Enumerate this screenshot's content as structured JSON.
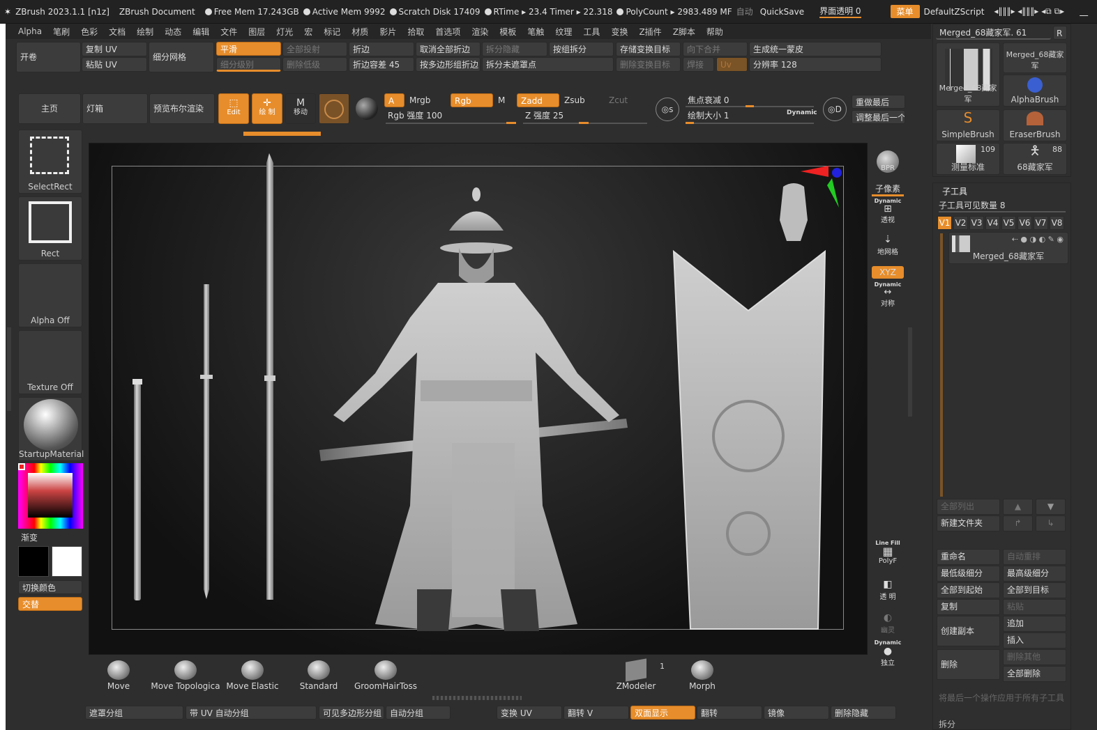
{
  "titlebar": {
    "app": "ZBrush 2023.1.1 [n1z]",
    "document": "ZBrush Document",
    "free_mem": "Free Mem 17.243GB",
    "active_mem": "Active Mem 9992",
    "scratch_disk": "Scratch Disk 17409",
    "rtime": "RTime ▸ 23.4 Timer ▸ 22.318",
    "polycount": "PolyCount ▸ 2983.489 MF",
    "auto": "自动",
    "quicksave": "QuickSave",
    "transparency": "界面透明 0",
    "menu": "菜单",
    "default_zscript": "DefaultZScript"
  },
  "menubar": [
    "Alpha",
    "笔刷",
    "色彩",
    "文档",
    "绘制",
    "动态",
    "编辑",
    "文件",
    "图层",
    "灯光",
    "宏",
    "标记",
    "材质",
    "影片",
    "拾取",
    "首选项",
    "渲染",
    "模板",
    "笔触",
    "纹理",
    "工具",
    "变换",
    "Z插件",
    "Z脚本",
    "帮助"
  ],
  "toolbar1": {
    "open": "开卷",
    "copy_uv": "复制 UV",
    "paste_uv": "粘贴 UV",
    "subdivide": "细分网格",
    "smooth": "平滑",
    "subdiv_level": "细分级别",
    "full_project": "全部投射",
    "delete_lower": "删除低级",
    "crease": "折边",
    "crease_tol": "折边容差 45",
    "uncrease_all": "取消全部折边",
    "crease_by_poly": "按多边形组折边",
    "split_hidden": "拆分隐藏",
    "split_unmasked": "拆分未遮罩点",
    "group_split": "按组拆分",
    "store_morph": "存储变换目标",
    "delete_morph": "删除变换目标",
    "merge_down": "向下合并",
    "weld": "焊接",
    "uv": "Uv",
    "unified_skin": "生成统一蒙皮",
    "resolution": "分辨率 128"
  },
  "toolbar2": {
    "home": "主页",
    "lightbox": "灯箱",
    "preview_bool": "预览布尔渲染",
    "edit": "Edit",
    "draw": "绘 制",
    "move": "移动",
    "a": "A",
    "mrgb": "Mrgb",
    "rgb": "Rgb",
    "m": "M",
    "zadd": "Zadd",
    "zsub": "Zsub",
    "zcut": "Zcut",
    "rgb_intensity": "Rgb 强度 100",
    "z_intensity": "Z 强度 25",
    "focal_shift": "焦点衰减 0",
    "draw_size": "绘制大小 1",
    "dynamic": "Dynamic",
    "redo_last": "重做最后",
    "adjust_last": "调整最后一个"
  },
  "left": {
    "select_rect": "SelectRect",
    "rect": "Rect",
    "alpha_off": "Alpha Off",
    "texture_off": "Texture Off",
    "material": "StartupMaterial",
    "gradient": "渐变",
    "switch_color": "切换颜色",
    "alternate": "交替"
  },
  "right_shelf": {
    "bpr": "BPR",
    "subpixel": "子像素",
    "dynamic1": "Dynamic",
    "persp": "透视",
    "floor": "地网格",
    "xyz": "XYZ",
    "dynamic2": "Dynamic",
    "sym": "对称",
    "linefill": "Line Fill",
    "polyf": "PolyF",
    "transp": "透 明",
    "ghost": "幽灵",
    "dynamic3": "Dynamic",
    "solo": "独立"
  },
  "tool_panel": {
    "header": "Merged_68藏家军. 61",
    "r": "R",
    "thumbs": [
      {
        "label": "Merged_68藏家军"
      },
      {
        "label": "Merged_68藏家军"
      },
      {
        "label": "AlphaBrush"
      },
      {
        "label": "SimpleBrush"
      },
      {
        "label": "EraserBrush"
      },
      {
        "label": "测量标准",
        "count": "109"
      },
      {
        "label": "68藏家军",
        "count": "88"
      }
    ],
    "subtool_title": "子工具",
    "visible_count": "子工具可见数量 8",
    "tabs": [
      "V1",
      "V2",
      "V3",
      "V4",
      "V5",
      "V6",
      "V7",
      "V8"
    ],
    "subtool_name": "Merged_68藏家军",
    "list_all": "全部列出",
    "new_folder": "新建文件夹",
    "rename": "重命名",
    "auto_reorder": "自动重排",
    "lowest": "最低级细分",
    "highest": "最高级细分",
    "all_to_start": "全部到起始",
    "all_to_target": "全部到目标",
    "copy": "复制",
    "paste": "粘贴",
    "duplicate": "创建副本",
    "append": "追加",
    "insert": "插入",
    "delete": "删除",
    "delete_other": "删除其他",
    "delete_all": "全部删除",
    "apply_last": "将最后一个操作应用于所有子工具",
    "split": "拆分"
  },
  "brushes": [
    {
      "label": "Move"
    },
    {
      "label": "Move Topologica"
    },
    {
      "label": "Move Elastic"
    },
    {
      "label": "Standard"
    },
    {
      "label": "GroomHairToss"
    },
    {
      "label": "ZModeler",
      "count": "1"
    },
    {
      "label": "Morph"
    }
  ],
  "bottom_bar": {
    "mask_groups": "遮罩分组",
    "uv_autogroup": "带 UV 自动分组",
    "visible_polygroup": "可见多边形分组",
    "autogroup": "自动分组",
    "morph_uv": "变换 UV",
    "flip_v": "翻转 V",
    "double": "双面显示",
    "flip": "翻转",
    "mirror": "镜像",
    "del_hidden": "删除隐藏"
  },
  "colors": {
    "accent": "#e78d2b",
    "bg": "#2e2e2e"
  }
}
